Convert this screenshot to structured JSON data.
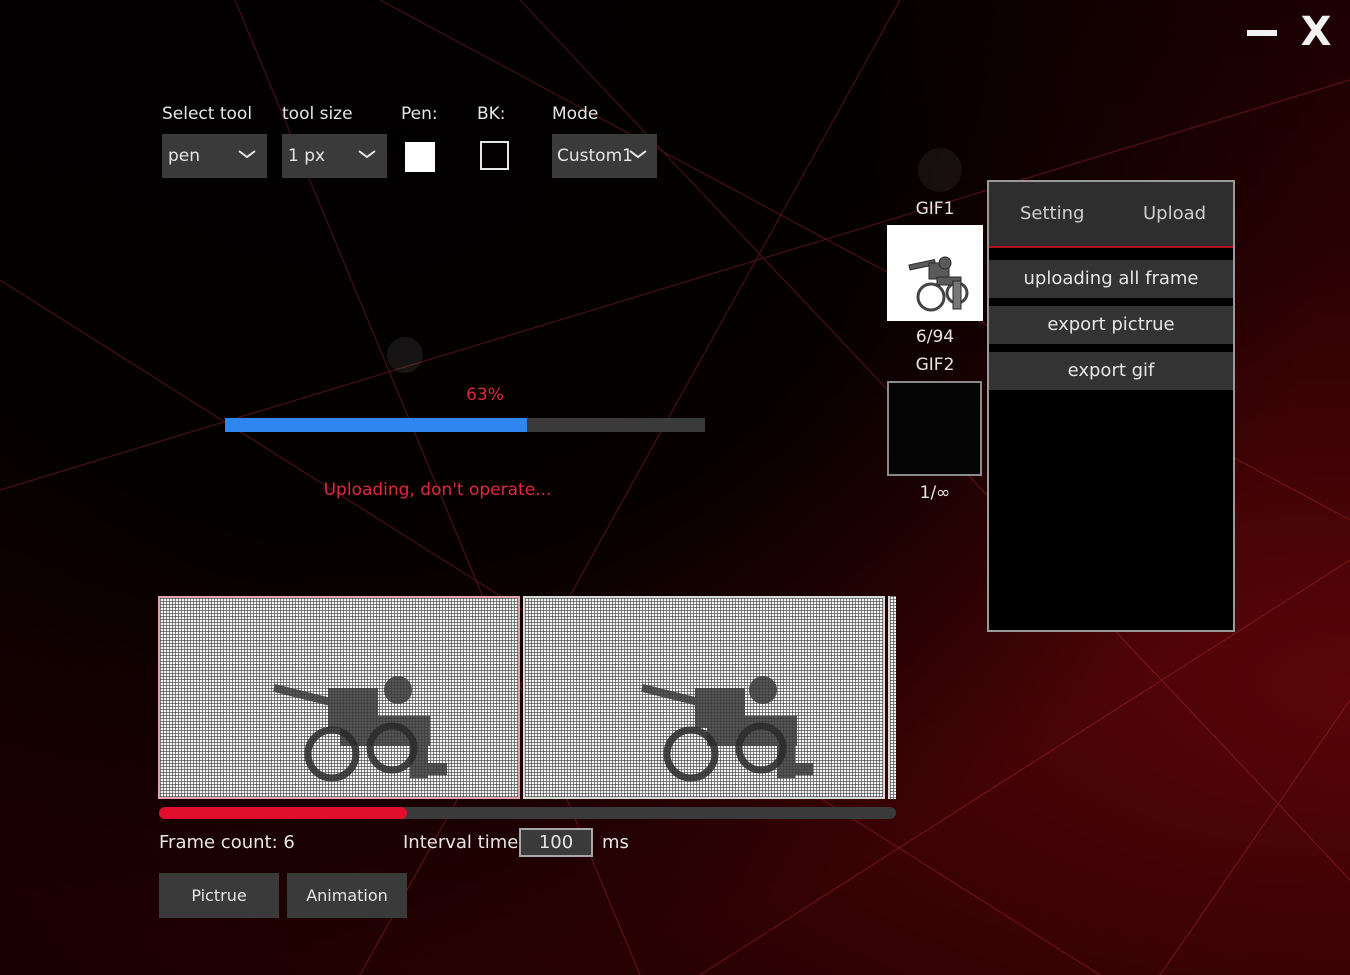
{
  "window": {
    "minimize_icon": "minimize-icon",
    "close_label": "X"
  },
  "toolbar": {
    "select_tool": {
      "label": "Select tool",
      "value": "pen"
    },
    "tool_size": {
      "label": "tool size",
      "value": "1 px"
    },
    "pen": {
      "label": "Pen:",
      "color": "#ffffff"
    },
    "bk": {
      "label": "BK:",
      "color": "transparent"
    },
    "mode": {
      "label": "Mode",
      "value": "Custom1"
    }
  },
  "progress": {
    "percent_text": "63%",
    "value": 0.63,
    "status": "Uploading, don't operate..."
  },
  "gifs": [
    {
      "label": "GIF1",
      "counter": "6/94"
    },
    {
      "label": "GIF2",
      "counter": "1/∞"
    }
  ],
  "panel": {
    "tabs": [
      "Setting",
      "Upload"
    ],
    "buttons": [
      "uploading all frame",
      "export pictrue",
      "export gif"
    ]
  },
  "frames": {
    "count_label": "Frame count:",
    "count": "6",
    "scroll_position": 0.34
  },
  "interval": {
    "label": "Interval time:",
    "value": "100",
    "unit": "ms"
  },
  "bottom_buttons": {
    "picture": "Pictrue",
    "animation": "Animation"
  },
  "colors": {
    "accent_red": "#e0102c",
    "progress_blue": "#2f86ee",
    "status_red": "#e0283a"
  }
}
